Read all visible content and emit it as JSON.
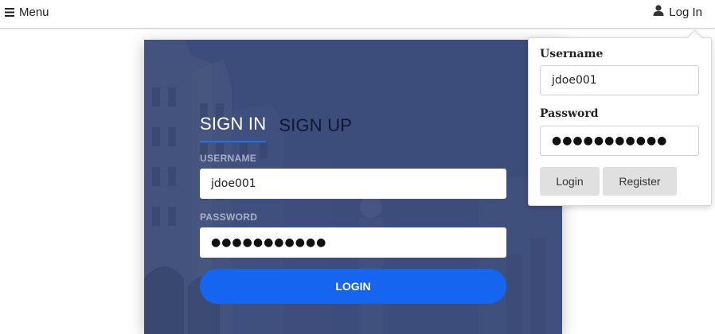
{
  "topbar": {
    "menu_icon": "hamburger-icon",
    "menu_label": "Menu",
    "user_icon": "user-icon",
    "login_label": "Log In"
  },
  "card": {
    "tabs": [
      {
        "label": "SIGN IN",
        "active": true
      },
      {
        "label": "SIGN UP",
        "active": false
      }
    ],
    "username_label": "USERNAME",
    "username_value": "jdoe001",
    "password_label": "PASSWORD",
    "password_value": "●●●●●●●●●●●",
    "login_button": "LOGIN"
  },
  "dropdown": {
    "username_label": "Username",
    "username_value": "jdoe001",
    "password_label": "Password",
    "password_value": "●●●●●●●●●●●",
    "login_button": "Login",
    "register_button": "Register"
  },
  "colors": {
    "accent": "#1565f0",
    "card_overlay": "#3d4e7c",
    "tab_underline": "#1a73e8"
  }
}
